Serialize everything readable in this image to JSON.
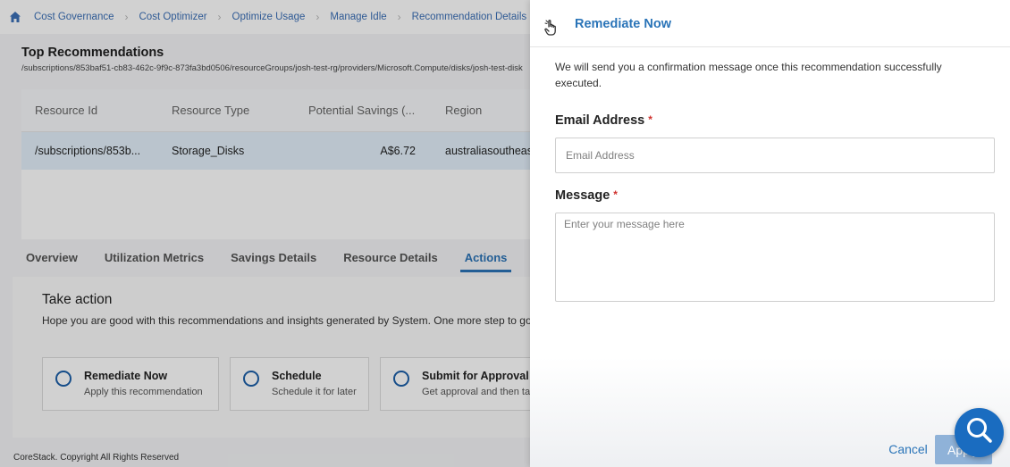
{
  "breadcrumb": {
    "items": [
      "Cost Governance",
      "Cost Optimizer",
      "Optimize Usage",
      "Manage Idle",
      "Recommendation Details"
    ]
  },
  "page": {
    "title": "Top Recommendations",
    "path": "/subscriptions/853baf51-cb83-462c-9f9c-873fa3bd0506/resourceGroups/josh-test-rg/providers/Microsoft.Compute/disks/josh-test-disk"
  },
  "table": {
    "headers": [
      "Resource Id",
      "Resource Type",
      "Potential Savings (...",
      "Region"
    ],
    "rows": [
      {
        "resource_id": "/subscriptions/853b...",
        "resource_type": "Storage_Disks",
        "savings": "A$6.72",
        "region": "australiasoutheast"
      }
    ]
  },
  "tabs": [
    "Overview",
    "Utilization Metrics",
    "Savings Details",
    "Resource Details",
    "Actions"
  ],
  "actions": {
    "title": "Take action",
    "description": "Hope you are good with this recommendations and insights generated by System. One more step to go",
    "options": [
      {
        "title": "Remediate Now",
        "subtitle": "Apply this recommendation"
      },
      {
        "title": "Schedule",
        "subtitle": "Schedule it for later"
      },
      {
        "title": "Submit for Approval",
        "subtitle": "Get approval and then take action"
      }
    ]
  },
  "footer": {
    "copyright": "CoreStack. Copyright All Rights Reserved"
  },
  "drawer": {
    "title": "Remediate Now",
    "description": "We will send you a confirmation message once this recommendation successfully executed.",
    "email_label": "Email Address",
    "email_placeholder": "Email Address",
    "message_label": "Message",
    "message_placeholder": "Enter your message here",
    "required_mark": "*",
    "cancel_label": "Cancel",
    "apply_label": "Apply"
  },
  "colors": {
    "accent": "#2a74b8",
    "required": "#d0312d",
    "selected_row": "#e3f0fb",
    "help_fab": "#1a6cc0"
  },
  "icons": {
    "home": "home-icon",
    "drawer": "hand-pointer-icon",
    "help": "search-icon"
  }
}
